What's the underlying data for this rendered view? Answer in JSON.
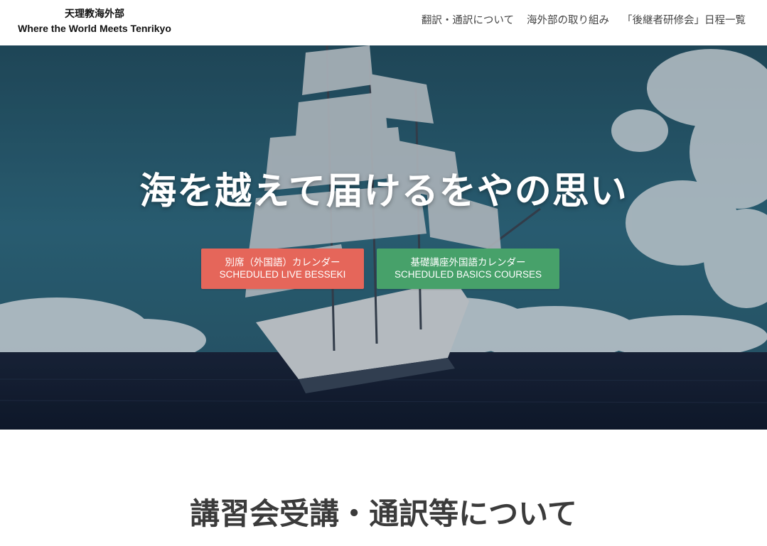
{
  "header": {
    "site_title_jp": "天理教海外部",
    "site_title_en": "Where the World Meets Tenrikyo",
    "nav": [
      {
        "label": "翻訳・通訳について"
      },
      {
        "label": "海外部の取り組み"
      },
      {
        "label": "「後継者研修会」日程一覧"
      }
    ]
  },
  "hero": {
    "background": "sailing-ship-at-sea-photo",
    "title": "海を越えて届けるをやの思い",
    "buttons": [
      {
        "line1": "別席（外国語）カレンダー",
        "line2": "SCHEDULED LIVE BESSEKI",
        "color": "#e5665a"
      },
      {
        "line1": "基礎講座外国語カレンダー",
        "line2": "SCHEDULED BASICS COURSES",
        "color": "#47a16a"
      }
    ]
  },
  "section": {
    "title": "講習会受講・通訳等について"
  }
}
